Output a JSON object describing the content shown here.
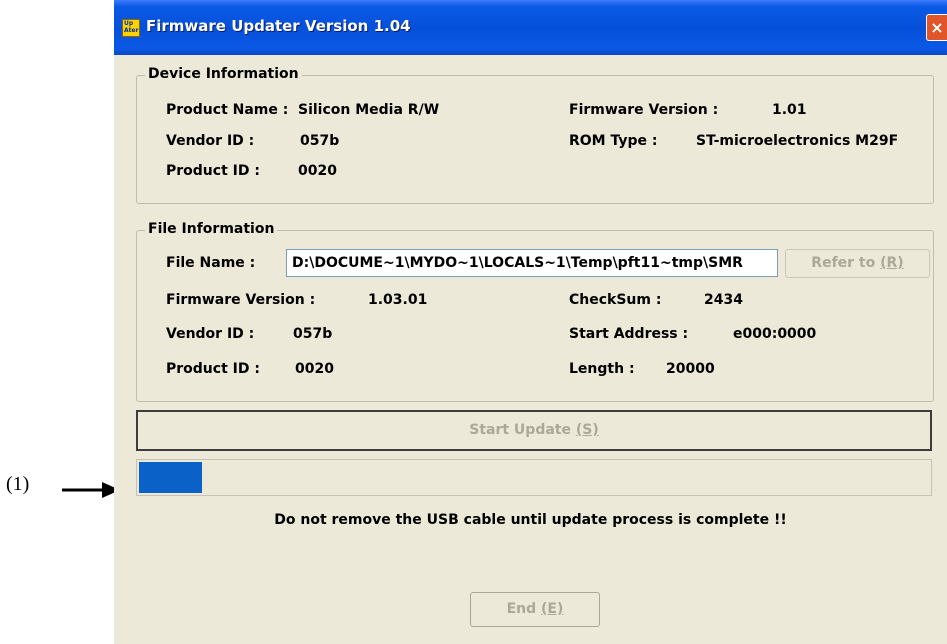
{
  "annotation": {
    "label": "(1)"
  },
  "window": {
    "title": "Firmware Updater Version 1.04",
    "close_glyph": "×",
    "app_icon_text": "Up Ater"
  },
  "device_info": {
    "group_title": "Device Information",
    "product_name_label": "Product Name :",
    "product_name_value": "Silicon Media R/W",
    "vendor_id_label": "Vendor ID :",
    "vendor_id_value": "057b",
    "product_id_label": "Product ID :",
    "product_id_value": "0020",
    "firmware_version_label": "Firmware Version :",
    "firmware_version_value": "1.01",
    "rom_type_label": "ROM Type :",
    "rom_type_value": "ST-microelectronics M29F"
  },
  "file_info": {
    "group_title": "File Information",
    "file_name_label": "File Name :",
    "file_name_value": "D:\\DOCUME~1\\MYDO~1\\LOCALS~1\\Temp\\pft11~tmp\\SMR",
    "refer_button": {
      "text": "Refer to ",
      "hotkey": "(R)"
    },
    "firmware_version_label": "Firmware Version :",
    "firmware_version_value": "1.03.01",
    "vendor_id_label": "Vendor ID :",
    "vendor_id_value": "057b",
    "product_id_label": "Product ID :",
    "product_id_value": "0020",
    "checksum_label": "CheckSum :",
    "checksum_value": "2434",
    "start_address_label": "Start Address :",
    "start_address_value": "e000:0000",
    "length_label": "Length :",
    "length_value": "20000"
  },
  "start_button": {
    "text": "Start Update ",
    "hotkey": "(S)"
  },
  "progress": {
    "fraction": 0.08,
    "fill_color": "#0a62c8"
  },
  "warning_text": "Do not remove the USB cable until update process is complete !!",
  "end_button": {
    "text": "End ",
    "hotkey": "(E)"
  },
  "colors": {
    "titlebar": "#0550da",
    "window_bg": "#ece9d8",
    "disabled_text": "#aca899"
  }
}
